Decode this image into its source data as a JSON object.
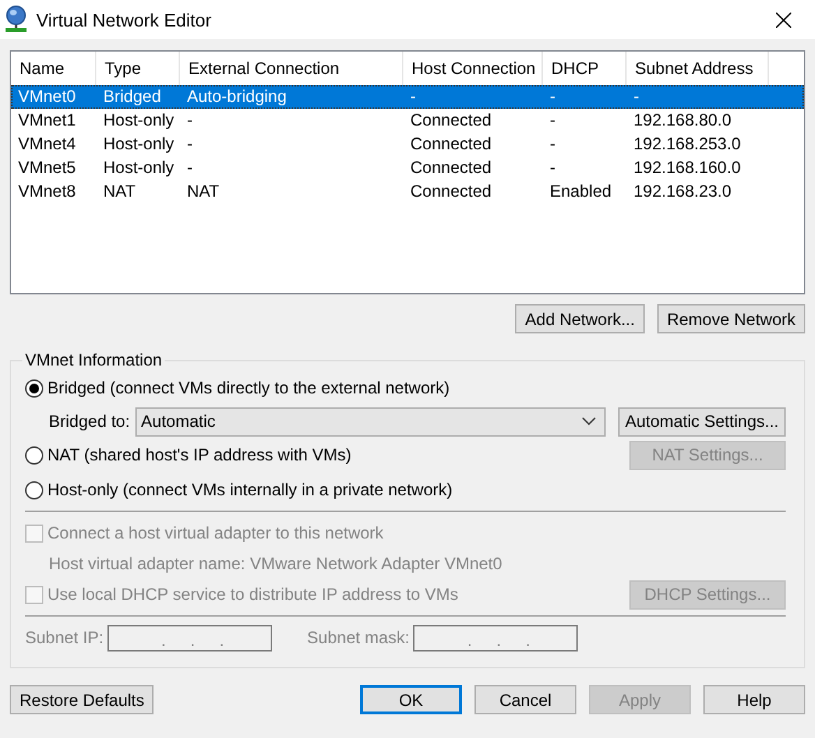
{
  "window": {
    "title": "Virtual Network Editor"
  },
  "table": {
    "columns": [
      "Name",
      "Type",
      "External Connection",
      "Host Connection",
      "DHCP",
      "Subnet Address"
    ],
    "rows": [
      {
        "cells": [
          "VMnet0",
          "Bridged",
          "Auto-bridging",
          "-",
          "-",
          "-"
        ],
        "selected": true
      },
      {
        "cells": [
          "VMnet1",
          "Host-only",
          "-",
          "Connected",
          "-",
          "192.168.80.0"
        ],
        "selected": false
      },
      {
        "cells": [
          "VMnet4",
          "Host-only",
          "-",
          "Connected",
          "-",
          "192.168.253.0"
        ],
        "selected": false
      },
      {
        "cells": [
          "VMnet5",
          "Host-only",
          "-",
          "Connected",
          "-",
          "192.168.160.0"
        ],
        "selected": false
      },
      {
        "cells": [
          "VMnet8",
          "NAT",
          "NAT",
          "Connected",
          "Enabled",
          "192.168.23.0"
        ],
        "selected": false
      }
    ]
  },
  "network_buttons": [
    {
      "label": "Add Network...",
      "disabled": false
    },
    {
      "label": "Remove Network",
      "disabled": false
    }
  ],
  "vmnet_info": {
    "title": "VMnet Information",
    "bridged": {
      "label": "Bridged (connect VMs directly to the external network)",
      "selected": true
    },
    "bridged_to": {
      "label": "Bridged to:",
      "value": "Automatic"
    },
    "automatic_settings": {
      "label": "Automatic Settings...",
      "disabled": false
    },
    "nat": {
      "label": "NAT (shared host's IP address with VMs)",
      "selected": false
    },
    "nat_settings": {
      "label": "NAT Settings...",
      "disabled": true
    },
    "host_only": {
      "label": "Host-only (connect VMs internally in a private network)",
      "selected": false
    },
    "connect_adapter": {
      "label": "Connect a host virtual adapter to this network",
      "checked": false,
      "disabled": true
    },
    "adapter_name": "Host virtual adapter name: VMware Network Adapter VMnet0",
    "use_dhcp": {
      "label": "Use local DHCP service to distribute IP address to VMs",
      "checked": false,
      "disabled": true
    },
    "dhcp_settings": {
      "label": "DHCP Settings...",
      "disabled": true
    },
    "subnet_ip": {
      "label": "Subnet IP:",
      "separators": [
        ".",
        ".",
        "."
      ]
    },
    "subnet_mask": {
      "label": "Subnet mask:",
      "separators": [
        ".",
        ".",
        "."
      ]
    }
  },
  "footer_buttons": [
    {
      "label": "Restore Defaults",
      "default": false,
      "disabled": false
    },
    {
      "label": "OK",
      "default": true,
      "disabled": false
    },
    {
      "label": "Cancel",
      "default": false,
      "disabled": false
    },
    {
      "label": "Apply",
      "default": false,
      "disabled": true
    },
    {
      "label": "Help",
      "default": false,
      "disabled": false
    }
  ]
}
